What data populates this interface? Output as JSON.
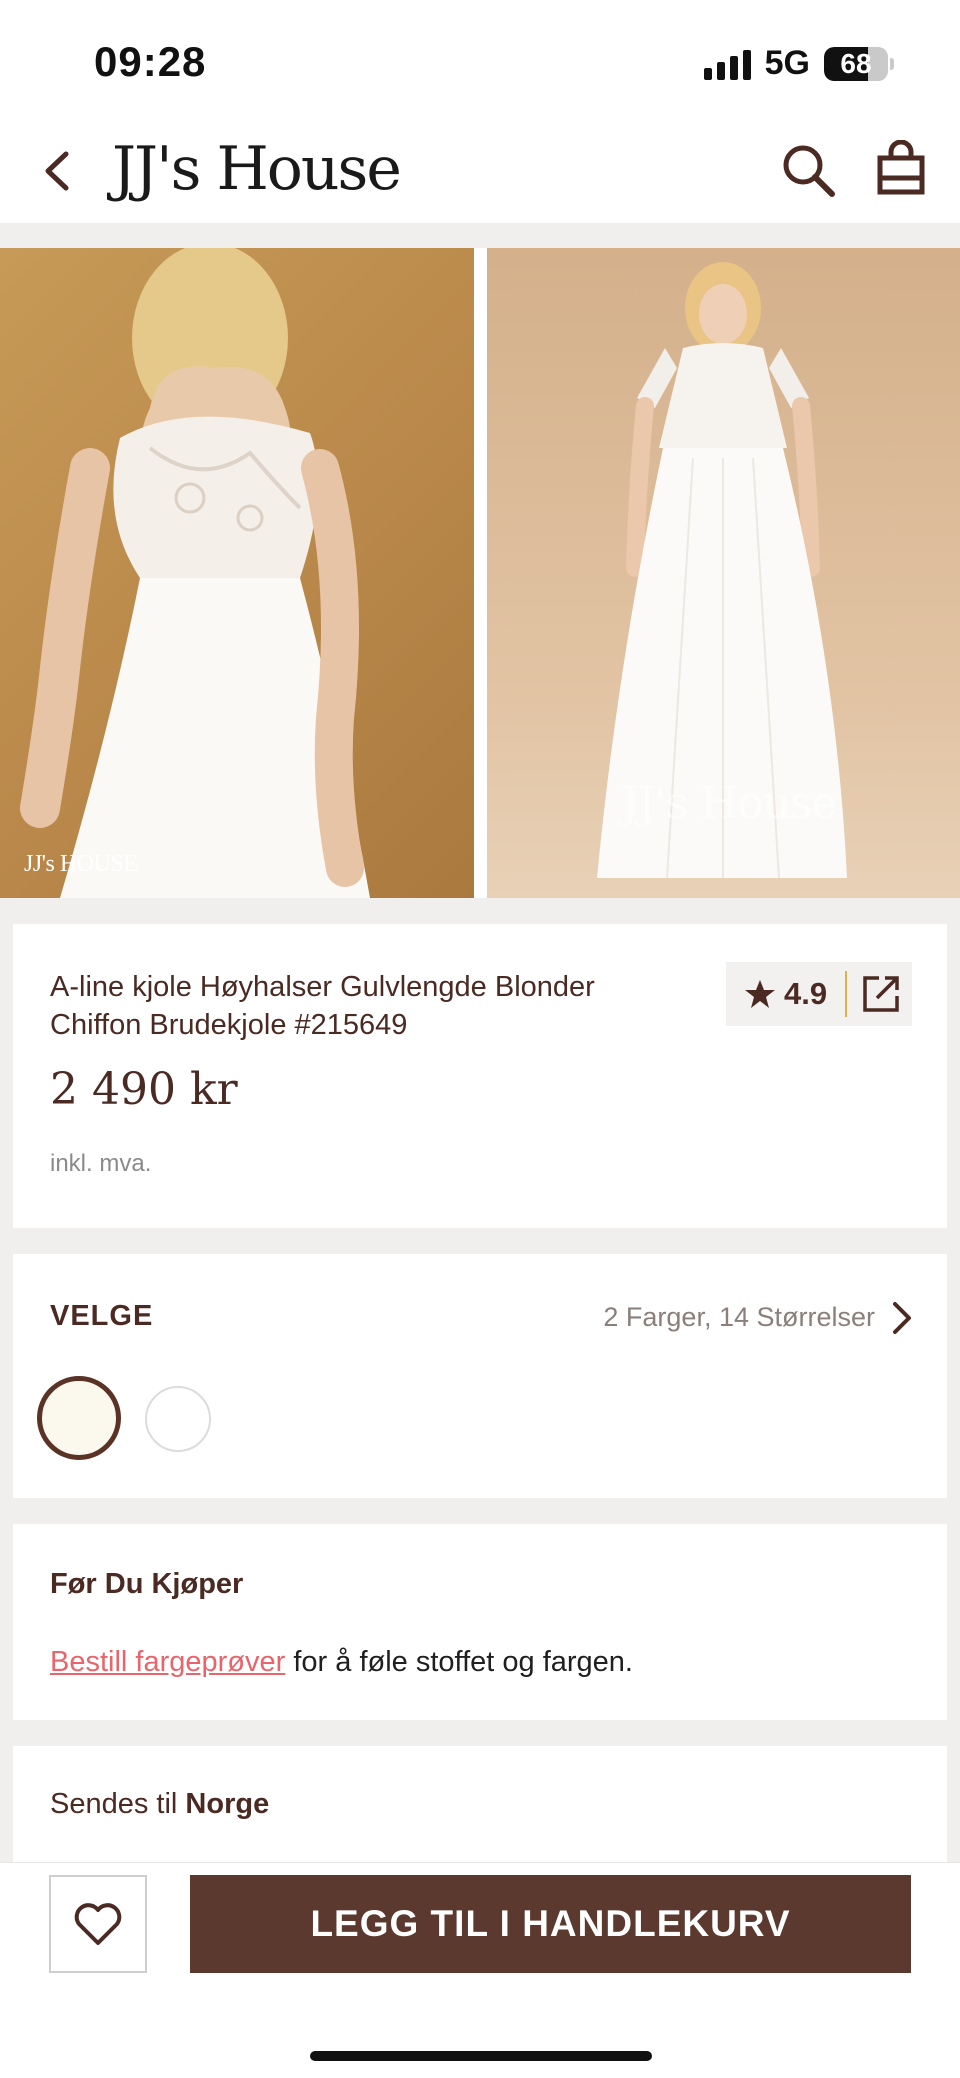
{
  "status_bar": {
    "time": "09:28",
    "network": "5G",
    "battery_percent": "68",
    "battery_level": 0.68
  },
  "header": {
    "brand": "JJ's House",
    "back_icon": "chevron-left-icon",
    "search_icon": "search-icon",
    "bag_icon": "shopping-bag-icon"
  },
  "gallery": {
    "images": [
      {
        "watermark": "JJ's HOUSE"
      },
      {
        "watermark": "JJ's House"
      }
    ]
  },
  "product": {
    "title": " A-line kjole Høyhalser Gulvlengde Blonder Chiffon Brudekjole  #215649",
    "rating": "4.9",
    "price": "2 490 kr",
    "tax_note": "inkl. mva."
  },
  "select": {
    "label": "VELGE",
    "summary": "2 Farger, 14 Størrelser",
    "swatches": [
      {
        "color": "#fbf9ee",
        "selected": true
      },
      {
        "color": "#ffffff",
        "selected": false
      }
    ]
  },
  "before_buying": {
    "title": "Før Du Kjøper",
    "link_text": "Bestill fargeprøver",
    "text": " for å føle stoffet og fargen."
  },
  "shipping": {
    "prefix": "Sendes til ",
    "country": "Norge"
  },
  "bottom_bar": {
    "add_to_cart": "LEGG TIL I HANDLEKURV"
  },
  "colors": {
    "brand_brown": "#5b392f",
    "link_pink": "#e8656b",
    "rating_divider": "#e0b04a"
  }
}
